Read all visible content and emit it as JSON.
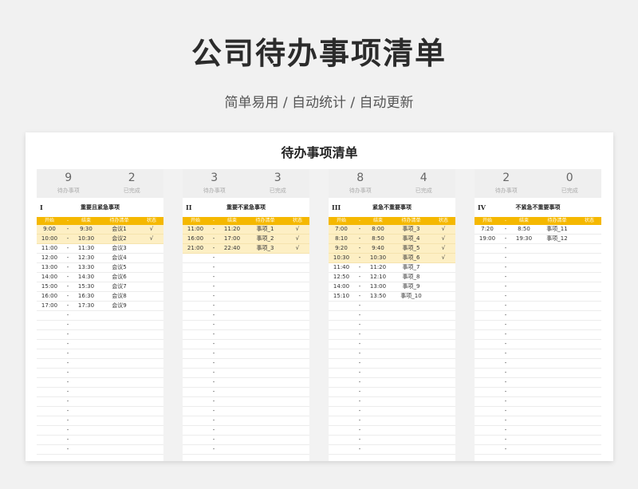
{
  "header": {
    "title": "公司待办事项清单",
    "subtitle": "简单易用 / 自动统计 / 自动更新"
  },
  "sheet": {
    "title": "待办事项清单",
    "pending_label": "待办事项",
    "done_label": "已完成",
    "columns": {
      "start": "开始",
      "dash": "-",
      "end": "结束",
      "todo": "待办清单",
      "status": "状态"
    },
    "quadrants": [
      {
        "numeral": "I",
        "title": "重要且紧急事项",
        "pending": "9",
        "done": "2",
        "rows": [
          {
            "start": "9:00",
            "dash": "-",
            "end": "9:30",
            "task": "会议1",
            "status": "√",
            "done": true
          },
          {
            "start": "10:00",
            "dash": "-",
            "end": "10:30",
            "task": "会议2",
            "status": "√",
            "done": true
          },
          {
            "start": "11:00",
            "dash": "-",
            "end": "11:30",
            "task": "会议3",
            "status": "",
            "done": false
          },
          {
            "start": "12:00",
            "dash": "-",
            "end": "12:30",
            "task": "会议4",
            "status": "",
            "done": false
          },
          {
            "start": "13:00",
            "dash": "-",
            "end": "13:30",
            "task": "会议5",
            "status": "",
            "done": false
          },
          {
            "start": "14:00",
            "dash": "-",
            "end": "14:30",
            "task": "会议6",
            "status": "",
            "done": false
          },
          {
            "start": "15:00",
            "dash": "-",
            "end": "15:30",
            "task": "会议7",
            "status": "",
            "done": false
          },
          {
            "start": "16:00",
            "dash": "-",
            "end": "16:30",
            "task": "会议8",
            "status": "",
            "done": false
          },
          {
            "start": "17:00",
            "dash": "-",
            "end": "17:30",
            "task": "会议9",
            "status": "",
            "done": false
          },
          {
            "start": "",
            "dash": "-",
            "end": "",
            "task": "",
            "status": "",
            "done": false
          },
          {
            "start": "",
            "dash": "-",
            "end": "",
            "task": "",
            "status": "",
            "done": false
          },
          {
            "start": "",
            "dash": "-",
            "end": "",
            "task": "",
            "status": "",
            "done": false
          },
          {
            "start": "",
            "dash": "-",
            "end": "",
            "task": "",
            "status": "",
            "done": false
          },
          {
            "start": "",
            "dash": "-",
            "end": "",
            "task": "",
            "status": "",
            "done": false
          },
          {
            "start": "",
            "dash": "-",
            "end": "",
            "task": "",
            "status": "",
            "done": false
          },
          {
            "start": "",
            "dash": "-",
            "end": "",
            "task": "",
            "status": "",
            "done": false
          },
          {
            "start": "",
            "dash": "-",
            "end": "",
            "task": "",
            "status": "",
            "done": false
          },
          {
            "start": "",
            "dash": "-",
            "end": "",
            "task": "",
            "status": "",
            "done": false
          },
          {
            "start": "",
            "dash": "-",
            "end": "",
            "task": "",
            "status": "",
            "done": false
          },
          {
            "start": "",
            "dash": "-",
            "end": "",
            "task": "",
            "status": "",
            "done": false
          },
          {
            "start": "",
            "dash": "-",
            "end": "",
            "task": "",
            "status": "",
            "done": false
          },
          {
            "start": "",
            "dash": "-",
            "end": "",
            "task": "",
            "status": "",
            "done": false
          },
          {
            "start": "",
            "dash": "-",
            "end": "",
            "task": "",
            "status": "",
            "done": false
          },
          {
            "start": "",
            "dash": "-",
            "end": "",
            "task": "",
            "status": "",
            "done": false
          }
        ]
      },
      {
        "numeral": "II",
        "title": "重要不紧急事项",
        "pending": "3",
        "done": "3",
        "rows": [
          {
            "start": "11:00",
            "dash": "-",
            "end": "11:20",
            "task": "事项_1",
            "status": "√",
            "done": true
          },
          {
            "start": "16:00",
            "dash": "-",
            "end": "17:00",
            "task": "事项_2",
            "status": "√",
            "done": true
          },
          {
            "start": "21:00",
            "dash": "-",
            "end": "22:40",
            "task": "事项_3",
            "status": "√",
            "done": true
          },
          {
            "start": "",
            "dash": "-",
            "end": "",
            "task": "",
            "status": "",
            "done": false
          },
          {
            "start": "",
            "dash": "-",
            "end": "",
            "task": "",
            "status": "",
            "done": false
          },
          {
            "start": "",
            "dash": "-",
            "end": "",
            "task": "",
            "status": "",
            "done": false
          },
          {
            "start": "",
            "dash": "-",
            "end": "",
            "task": "",
            "status": "",
            "done": false
          },
          {
            "start": "",
            "dash": "-",
            "end": "",
            "task": "",
            "status": "",
            "done": false
          },
          {
            "start": "",
            "dash": "-",
            "end": "",
            "task": "",
            "status": "",
            "done": false
          },
          {
            "start": "",
            "dash": "-",
            "end": "",
            "task": "",
            "status": "",
            "done": false
          },
          {
            "start": "",
            "dash": "-",
            "end": "",
            "task": "",
            "status": "",
            "done": false
          },
          {
            "start": "",
            "dash": "-",
            "end": "",
            "task": "",
            "status": "",
            "done": false
          },
          {
            "start": "",
            "dash": "-",
            "end": "",
            "task": "",
            "status": "",
            "done": false
          },
          {
            "start": "",
            "dash": "-",
            "end": "",
            "task": "",
            "status": "",
            "done": false
          },
          {
            "start": "",
            "dash": "-",
            "end": "",
            "task": "",
            "status": "",
            "done": false
          },
          {
            "start": "",
            "dash": "-",
            "end": "",
            "task": "",
            "status": "",
            "done": false
          },
          {
            "start": "",
            "dash": "-",
            "end": "",
            "task": "",
            "status": "",
            "done": false
          },
          {
            "start": "",
            "dash": "-",
            "end": "",
            "task": "",
            "status": "",
            "done": false
          },
          {
            "start": "",
            "dash": "-",
            "end": "",
            "task": "",
            "status": "",
            "done": false
          },
          {
            "start": "",
            "dash": "-",
            "end": "",
            "task": "",
            "status": "",
            "done": false
          },
          {
            "start": "",
            "dash": "-",
            "end": "",
            "task": "",
            "status": "",
            "done": false
          },
          {
            "start": "",
            "dash": "-",
            "end": "",
            "task": "",
            "status": "",
            "done": false
          },
          {
            "start": "",
            "dash": "-",
            "end": "",
            "task": "",
            "status": "",
            "done": false
          },
          {
            "start": "",
            "dash": "-",
            "end": "",
            "task": "",
            "status": "",
            "done": false
          }
        ]
      },
      {
        "numeral": "III",
        "title": "紧急不重要事项",
        "pending": "8",
        "done": "4",
        "rows": [
          {
            "start": "7:00",
            "dash": "-",
            "end": "8:00",
            "task": "事项_3",
            "status": "√",
            "done": true
          },
          {
            "start": "8:10",
            "dash": "-",
            "end": "8:50",
            "task": "事项_4",
            "status": "√",
            "done": true
          },
          {
            "start": "9:20",
            "dash": "-",
            "end": "9:40",
            "task": "事项_5",
            "status": "√",
            "done": true
          },
          {
            "start": "10:30",
            "dash": "-",
            "end": "10:30",
            "task": "事项_6",
            "status": "√",
            "done": true
          },
          {
            "start": "11:40",
            "dash": "-",
            "end": "11:20",
            "task": "事项_7",
            "status": "",
            "done": false
          },
          {
            "start": "12:50",
            "dash": "-",
            "end": "12:10",
            "task": "事项_8",
            "status": "",
            "done": false
          },
          {
            "start": "14:00",
            "dash": "-",
            "end": "13:00",
            "task": "事项_9",
            "status": "",
            "done": false
          },
          {
            "start": "15:10",
            "dash": "-",
            "end": "13:50",
            "task": "事项_10",
            "status": "",
            "done": false
          },
          {
            "start": "",
            "dash": "-",
            "end": "",
            "task": "",
            "status": "",
            "done": false
          },
          {
            "start": "",
            "dash": "-",
            "end": "",
            "task": "",
            "status": "",
            "done": false
          },
          {
            "start": "",
            "dash": "-",
            "end": "",
            "task": "",
            "status": "",
            "done": false
          },
          {
            "start": "",
            "dash": "-",
            "end": "",
            "task": "",
            "status": "",
            "done": false
          },
          {
            "start": "",
            "dash": "-",
            "end": "",
            "task": "",
            "status": "",
            "done": false
          },
          {
            "start": "",
            "dash": "-",
            "end": "",
            "task": "",
            "status": "",
            "done": false
          },
          {
            "start": "",
            "dash": "-",
            "end": "",
            "task": "",
            "status": "",
            "done": false
          },
          {
            "start": "",
            "dash": "-",
            "end": "",
            "task": "",
            "status": "",
            "done": false
          },
          {
            "start": "",
            "dash": "-",
            "end": "",
            "task": "",
            "status": "",
            "done": false
          },
          {
            "start": "",
            "dash": "-",
            "end": "",
            "task": "",
            "status": "",
            "done": false
          },
          {
            "start": "",
            "dash": "-",
            "end": "",
            "task": "",
            "status": "",
            "done": false
          },
          {
            "start": "",
            "dash": "-",
            "end": "",
            "task": "",
            "status": "",
            "done": false
          },
          {
            "start": "",
            "dash": "-",
            "end": "",
            "task": "",
            "status": "",
            "done": false
          },
          {
            "start": "",
            "dash": "-",
            "end": "",
            "task": "",
            "status": "",
            "done": false
          },
          {
            "start": "",
            "dash": "-",
            "end": "",
            "task": "",
            "status": "",
            "done": false
          },
          {
            "start": "",
            "dash": "-",
            "end": "",
            "task": "",
            "status": "",
            "done": false
          }
        ]
      },
      {
        "numeral": "IV",
        "title": "不紧急不重要事项",
        "pending": "2",
        "done": "0",
        "rows": [
          {
            "start": "7:20",
            "dash": "-",
            "end": "8:50",
            "task": "事项_11",
            "status": "",
            "done": false
          },
          {
            "start": "19:00",
            "dash": "-",
            "end": "19:30",
            "task": "事项_12",
            "status": "",
            "done": false
          },
          {
            "start": "",
            "dash": "-",
            "end": "",
            "task": "",
            "status": "",
            "done": false
          },
          {
            "start": "",
            "dash": "-",
            "end": "",
            "task": "",
            "status": "",
            "done": false
          },
          {
            "start": "",
            "dash": "-",
            "end": "",
            "task": "",
            "status": "",
            "done": false
          },
          {
            "start": "",
            "dash": "-",
            "end": "",
            "task": "",
            "status": "",
            "done": false
          },
          {
            "start": "",
            "dash": "-",
            "end": "",
            "task": "",
            "status": "",
            "done": false
          },
          {
            "start": "",
            "dash": "-",
            "end": "",
            "task": "",
            "status": "",
            "done": false
          },
          {
            "start": "",
            "dash": "-",
            "end": "",
            "task": "",
            "status": "",
            "done": false
          },
          {
            "start": "",
            "dash": "-",
            "end": "",
            "task": "",
            "status": "",
            "done": false
          },
          {
            "start": "",
            "dash": "-",
            "end": "",
            "task": "",
            "status": "",
            "done": false
          },
          {
            "start": "",
            "dash": "-",
            "end": "",
            "task": "",
            "status": "",
            "done": false
          },
          {
            "start": "",
            "dash": "-",
            "end": "",
            "task": "",
            "status": "",
            "done": false
          },
          {
            "start": "",
            "dash": "-",
            "end": "",
            "task": "",
            "status": "",
            "done": false
          },
          {
            "start": "",
            "dash": "-",
            "end": "",
            "task": "",
            "status": "",
            "done": false
          },
          {
            "start": "",
            "dash": "-",
            "end": "",
            "task": "",
            "status": "",
            "done": false
          },
          {
            "start": "",
            "dash": "-",
            "end": "",
            "task": "",
            "status": "",
            "done": false
          },
          {
            "start": "",
            "dash": "-",
            "end": "",
            "task": "",
            "status": "",
            "done": false
          },
          {
            "start": "",
            "dash": "-",
            "end": "",
            "task": "",
            "status": "",
            "done": false
          },
          {
            "start": "",
            "dash": "-",
            "end": "",
            "task": "",
            "status": "",
            "done": false
          },
          {
            "start": "",
            "dash": "-",
            "end": "",
            "task": "",
            "status": "",
            "done": false
          },
          {
            "start": "",
            "dash": "-",
            "end": "",
            "task": "",
            "status": "",
            "done": false
          },
          {
            "start": "",
            "dash": "-",
            "end": "",
            "task": "",
            "status": "",
            "done": false
          },
          {
            "start": "",
            "dash": "-",
            "end": "",
            "task": "",
            "status": "",
            "done": false
          }
        ]
      }
    ]
  }
}
